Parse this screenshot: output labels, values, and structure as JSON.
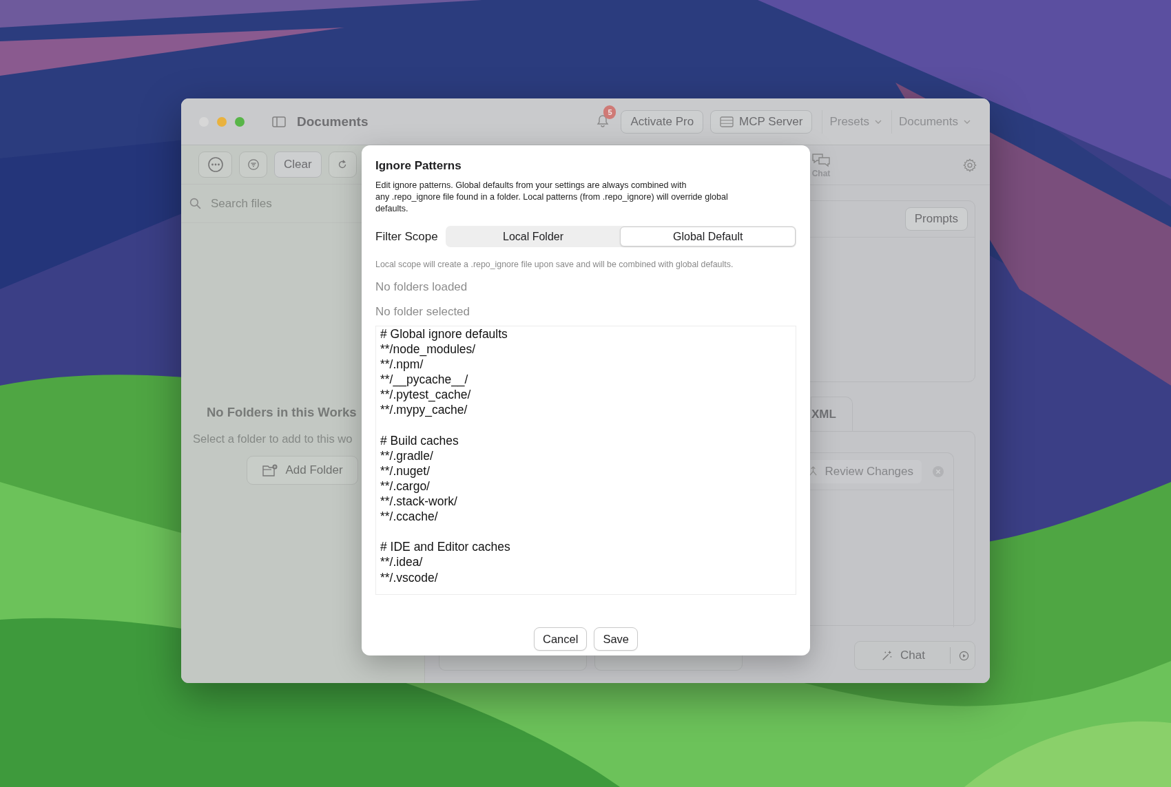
{
  "window": {
    "title": "Documents",
    "notification_count": "5",
    "buttons": [
      "Activate Pro",
      "MCP Server"
    ],
    "menus": [
      "Presets",
      "Documents"
    ]
  },
  "sidebar": {
    "clear_button": "Clear",
    "search": {
      "placeholder": "Search files"
    },
    "empty_title": "No Folders in this Works",
    "empty_text": "Select a folder to add to this wo",
    "add_button": "Add Folder"
  },
  "main": {
    "toolbar_label": "Chat",
    "prompts_button": "Prompts",
    "tab": "XML",
    "review_button": "Review Changes",
    "bottom_bar": {
      "chat_button": "Chat"
    }
  },
  "dialog": {
    "title": "Ignore Patterns",
    "description": "Edit ignore patterns. Global defaults from your settings are always combined with\nany .repo_ignore file found in a folder. Local patterns (from .repo_ignore) will override global\ndefaults.",
    "scope_label": "Filter Scope",
    "scope_options": [
      {
        "label": "Local Folder",
        "selected": false
      },
      {
        "label": "Global Default",
        "selected": true
      }
    ],
    "scope_hint": "Local scope will create a .repo_ignore file upon save and will be combined with global defaults.",
    "folders_status": "No folders loaded",
    "folder_status": "No folder selected",
    "patterns": "# Global ignore defaults\n**/node_modules/\n**/.npm/\n**/__pycache__/\n**/.pytest_cache/\n**/.mypy_cache/\n\n# Build caches\n**/.gradle/\n**/.nuget/\n**/.cargo/\n**/.stack-work/\n**/.ccache/\n\n# IDE and Editor caches\n**/.idea/\n**/.vscode/",
    "buttons": [
      "Cancel",
      "Save"
    ]
  }
}
